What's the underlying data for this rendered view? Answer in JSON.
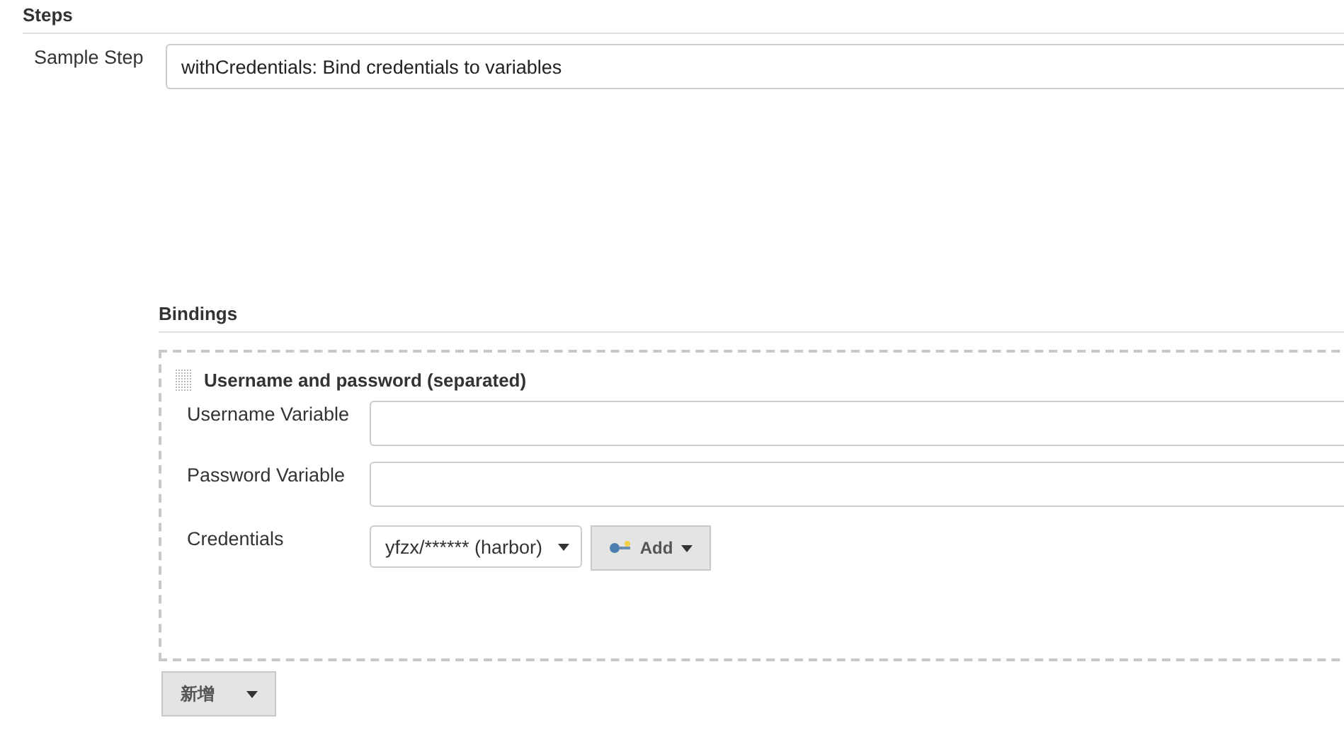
{
  "section_title": "Steps",
  "sample_step": {
    "label": "Sample Step",
    "value": "withCredentials: Bind credentials to variables"
  },
  "bindings": {
    "title": "Bindings",
    "binding": {
      "title": "Username and password (separated)",
      "fields": [
        {
          "kind": "text",
          "label": "Username Variable"
        },
        {
          "kind": "text",
          "label": "Password Variable"
        },
        {
          "kind": "select",
          "label": "Credentials",
          "value": "yfzx/****** (harbor)",
          "button": "Add"
        }
      ]
    }
  },
  "add_button": "新增"
}
